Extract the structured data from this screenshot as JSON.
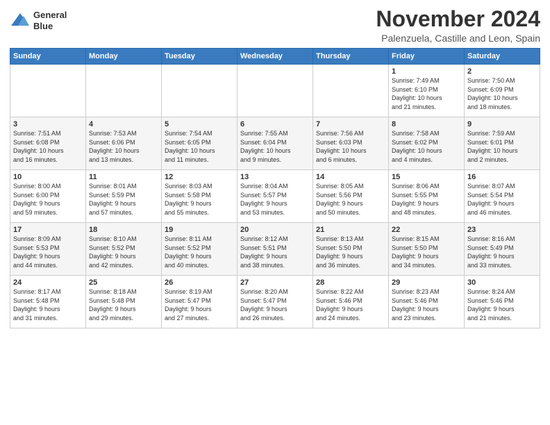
{
  "header": {
    "logo_line1": "General",
    "logo_line2": "Blue",
    "month_title": "November 2024",
    "location": "Palenzuela, Castille and Leon, Spain"
  },
  "weekdays": [
    "Sunday",
    "Monday",
    "Tuesday",
    "Wednesday",
    "Thursday",
    "Friday",
    "Saturday"
  ],
  "weeks": [
    [
      {
        "day": "",
        "info": ""
      },
      {
        "day": "",
        "info": ""
      },
      {
        "day": "",
        "info": ""
      },
      {
        "day": "",
        "info": ""
      },
      {
        "day": "",
        "info": ""
      },
      {
        "day": "1",
        "info": "Sunrise: 7:49 AM\nSunset: 6:10 PM\nDaylight: 10 hours\nand 21 minutes."
      },
      {
        "day": "2",
        "info": "Sunrise: 7:50 AM\nSunset: 6:09 PM\nDaylight: 10 hours\nand 18 minutes."
      }
    ],
    [
      {
        "day": "3",
        "info": "Sunrise: 7:51 AM\nSunset: 6:08 PM\nDaylight: 10 hours\nand 16 minutes."
      },
      {
        "day": "4",
        "info": "Sunrise: 7:53 AM\nSunset: 6:06 PM\nDaylight: 10 hours\nand 13 minutes."
      },
      {
        "day": "5",
        "info": "Sunrise: 7:54 AM\nSunset: 6:05 PM\nDaylight: 10 hours\nand 11 minutes."
      },
      {
        "day": "6",
        "info": "Sunrise: 7:55 AM\nSunset: 6:04 PM\nDaylight: 10 hours\nand 9 minutes."
      },
      {
        "day": "7",
        "info": "Sunrise: 7:56 AM\nSunset: 6:03 PM\nDaylight: 10 hours\nand 6 minutes."
      },
      {
        "day": "8",
        "info": "Sunrise: 7:58 AM\nSunset: 6:02 PM\nDaylight: 10 hours\nand 4 minutes."
      },
      {
        "day": "9",
        "info": "Sunrise: 7:59 AM\nSunset: 6:01 PM\nDaylight: 10 hours\nand 2 minutes."
      }
    ],
    [
      {
        "day": "10",
        "info": "Sunrise: 8:00 AM\nSunset: 6:00 PM\nDaylight: 9 hours\nand 59 minutes."
      },
      {
        "day": "11",
        "info": "Sunrise: 8:01 AM\nSunset: 5:59 PM\nDaylight: 9 hours\nand 57 minutes."
      },
      {
        "day": "12",
        "info": "Sunrise: 8:03 AM\nSunset: 5:58 PM\nDaylight: 9 hours\nand 55 minutes."
      },
      {
        "day": "13",
        "info": "Sunrise: 8:04 AM\nSunset: 5:57 PM\nDaylight: 9 hours\nand 53 minutes."
      },
      {
        "day": "14",
        "info": "Sunrise: 8:05 AM\nSunset: 5:56 PM\nDaylight: 9 hours\nand 50 minutes."
      },
      {
        "day": "15",
        "info": "Sunrise: 8:06 AM\nSunset: 5:55 PM\nDaylight: 9 hours\nand 48 minutes."
      },
      {
        "day": "16",
        "info": "Sunrise: 8:07 AM\nSunset: 5:54 PM\nDaylight: 9 hours\nand 46 minutes."
      }
    ],
    [
      {
        "day": "17",
        "info": "Sunrise: 8:09 AM\nSunset: 5:53 PM\nDaylight: 9 hours\nand 44 minutes."
      },
      {
        "day": "18",
        "info": "Sunrise: 8:10 AM\nSunset: 5:52 PM\nDaylight: 9 hours\nand 42 minutes."
      },
      {
        "day": "19",
        "info": "Sunrise: 8:11 AM\nSunset: 5:52 PM\nDaylight: 9 hours\nand 40 minutes."
      },
      {
        "day": "20",
        "info": "Sunrise: 8:12 AM\nSunset: 5:51 PM\nDaylight: 9 hours\nand 38 minutes."
      },
      {
        "day": "21",
        "info": "Sunrise: 8:13 AM\nSunset: 5:50 PM\nDaylight: 9 hours\nand 36 minutes."
      },
      {
        "day": "22",
        "info": "Sunrise: 8:15 AM\nSunset: 5:50 PM\nDaylight: 9 hours\nand 34 minutes."
      },
      {
        "day": "23",
        "info": "Sunrise: 8:16 AM\nSunset: 5:49 PM\nDaylight: 9 hours\nand 33 minutes."
      }
    ],
    [
      {
        "day": "24",
        "info": "Sunrise: 8:17 AM\nSunset: 5:48 PM\nDaylight: 9 hours\nand 31 minutes."
      },
      {
        "day": "25",
        "info": "Sunrise: 8:18 AM\nSunset: 5:48 PM\nDaylight: 9 hours\nand 29 minutes."
      },
      {
        "day": "26",
        "info": "Sunrise: 8:19 AM\nSunset: 5:47 PM\nDaylight: 9 hours\nand 27 minutes."
      },
      {
        "day": "27",
        "info": "Sunrise: 8:20 AM\nSunset: 5:47 PM\nDaylight: 9 hours\nand 26 minutes."
      },
      {
        "day": "28",
        "info": "Sunrise: 8:22 AM\nSunset: 5:46 PM\nDaylight: 9 hours\nand 24 minutes."
      },
      {
        "day": "29",
        "info": "Sunrise: 8:23 AM\nSunset: 5:46 PM\nDaylight: 9 hours\nand 23 minutes."
      },
      {
        "day": "30",
        "info": "Sunrise: 8:24 AM\nSunset: 5:46 PM\nDaylight: 9 hours\nand 21 minutes."
      }
    ]
  ]
}
